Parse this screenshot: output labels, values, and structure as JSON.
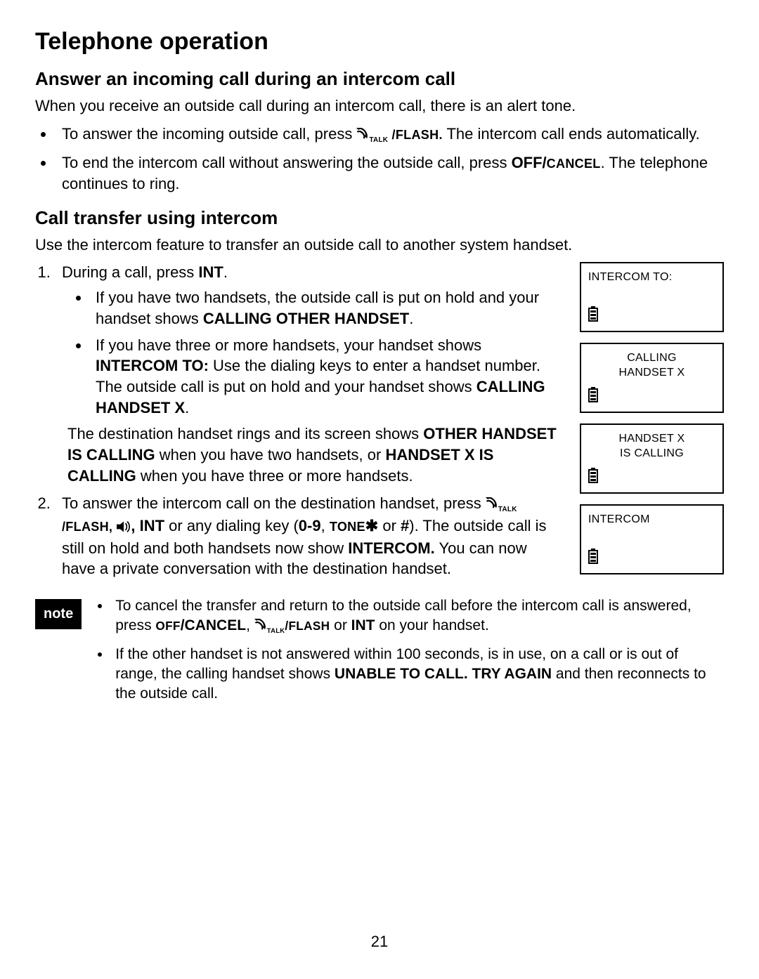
{
  "pageNumber": "21",
  "title": "Telephone operation",
  "section1": {
    "heading": "Answer an incoming call during an intercom call",
    "intro": "When you receive an outside call during an intercom call, there is an alert tone.",
    "bullets": {
      "b1_pre": "To answer the incoming outside call, press ",
      "b1_key": "/FLASH.",
      "b1_post": " The intercom call ends automatically.",
      "b2_pre": "To end the intercom call without answering the outside call, press ",
      "b2_key": "OFF/",
      "b2_key2": "CANCEL",
      "b2_post": ". The telephone continues to ring."
    }
  },
  "section2": {
    "heading": "Call transfer using intercom",
    "intro": "Use the intercom feature to transfer an outside call to another system handset.",
    "step1_pre": "During a call, press ",
    "step1_key": "INT",
    "step1_post": ".",
    "step1_sub1_pre": "If you have two handsets, the outside call is put on hold and your handset shows ",
    "step1_sub1_bold": "CALLING OTHER HANDSET",
    "step1_sub1_post": ".",
    "step1_sub2_pre": "If you have three or more handsets, your handset shows ",
    "step1_sub2_bold": "INTERCOM TO:",
    "step1_sub2_mid": " Use the dialing keys to enter a handset number. The outside call is put on hold and your handset shows ",
    "step1_sub2_bold2": "CALLING HANDSET X",
    "step1_sub2_post": ".",
    "step1_para2_pre": "The destination handset rings and its screen shows ",
    "step1_para2_bold1": "OTHER HANDSET IS CALLING",
    "step1_para2_mid": " when you have two handsets, or ",
    "step1_para2_bold2": "HANDSET X IS CALLING",
    "step1_para2_post": " when you have three or more handsets.",
    "step2_pre": "To answer the intercom call on the destination handset, press ",
    "step2_key1": "/FLASH,",
    "step2_key2": "INT",
    "step2_mid1": " or any dialing key (",
    "step2_key3": "0-9",
    "step2_mid2": ", ",
    "step2_key4": "TONE",
    "step2_key4b": " or ",
    "step2_key5": "#",
    "step2_mid3": "). The outside call is still on hold and both handsets now show ",
    "step2_bold": "INTERCOM.",
    "step2_post": " You can now have a private conversation with the destination handset."
  },
  "note": {
    "label": "note",
    "n1_pre": "To cancel the transfer and return to the outside call before the intercom call is answered, press ",
    "n1_key1a": "OFF",
    "n1_key1b": "/CANCEL",
    "n1_sep1": ", ",
    "n1_key2": "/FLASH",
    "n1_sep2": " or ",
    "n1_key3": "INT",
    "n1_post": " on your handset.",
    "n2_pre": "If the other handset is not answered within 100 seconds, is in use, on a call or is out of range, the calling handset shows ",
    "n2_bold": "UNABLE TO CALL. TRY AGAIN",
    "n2_post": " and then reconnects to the outside call."
  },
  "screens": {
    "s1_line1": "INTERCOM TO:",
    "s2_line1": "CALLING",
    "s2_line2": "HANDSET X",
    "s3_line1": "HANDSET X",
    "s3_line2": "IS CALLING",
    "s4_line1": "INTERCOM"
  },
  "icons": {
    "talk": "TALK",
    "x": "✱"
  }
}
